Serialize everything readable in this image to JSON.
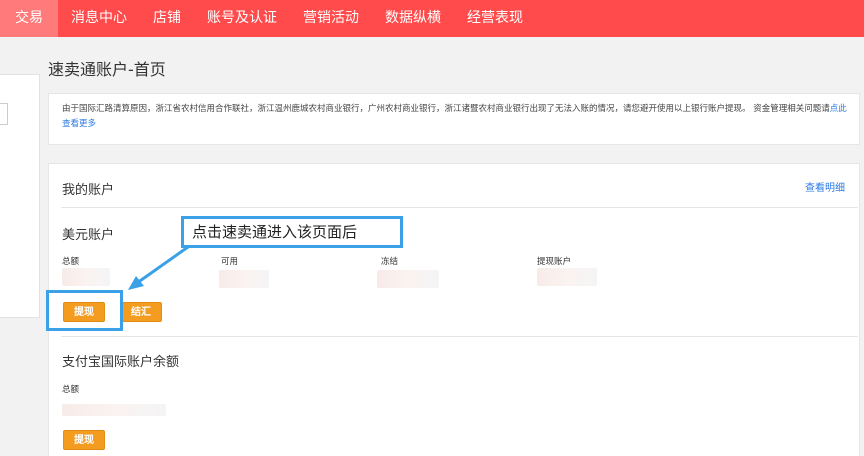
{
  "nav": {
    "items": [
      {
        "label": "交易",
        "active": true
      },
      {
        "label": "消息中心"
      },
      {
        "label": "店铺"
      },
      {
        "label": "账号及认证"
      },
      {
        "label": "营销活动"
      },
      {
        "label": "数据纵横"
      },
      {
        "label": "经营表现"
      }
    ]
  },
  "page": {
    "title": "速卖通账户-首页"
  },
  "notice": {
    "text": "由于国际汇路清算原因，浙江省农村信用合作联社，浙江温州鹿城农村商业银行，广州农村商业银行，浙江诸暨农村商业银行出现了无法入账的情况，请您避开使用以上银行账户提现。 资金管理相关问题请",
    "link": "点此查看更多"
  },
  "account": {
    "title": "我的账户",
    "detail_link": "查看明细",
    "usd": {
      "title": "美元账户",
      "labels": {
        "total": "总额",
        "available": "可用",
        "frozen": "冻结",
        "withdraw_account": "提现账户"
      },
      "withdraw_button": "提现",
      "exchange_button": "结汇"
    },
    "alipay": {
      "title": "支付宝国际账户余额",
      "total_label": "总额",
      "withdraw_button": "提现"
    }
  },
  "annotation": {
    "callout_text": "点击速卖通进入该页面后",
    "color": "#3aa0e8"
  },
  "colors": {
    "nav_bg": "#ff4b4b",
    "nav_active": "#ff7a7a",
    "button": "#f39c1f",
    "link": "#2b78e4"
  }
}
